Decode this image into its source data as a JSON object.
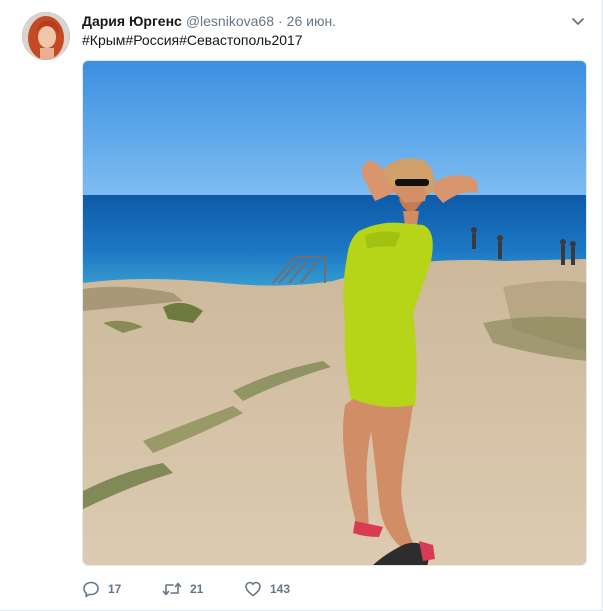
{
  "tweet": {
    "author": {
      "name": "Дария Юргенс",
      "handle": "@lesnikova68"
    },
    "separator": "·",
    "timestamp": "26 июн.",
    "hashtags": [
      "#Крым",
      "#Россия",
      "#Севастополь2017"
    ],
    "media": {
      "icon": "photo"
    },
    "actions": {
      "reply": {
        "icon": "reply-icon",
        "count": "17"
      },
      "retweet": {
        "icon": "retweet-icon",
        "count": "21"
      },
      "like": {
        "icon": "heart-icon",
        "count": "143"
      }
    },
    "colors": {
      "text": "#14171a",
      "secondary": "#657786",
      "border": "#e1e8ed"
    }
  }
}
